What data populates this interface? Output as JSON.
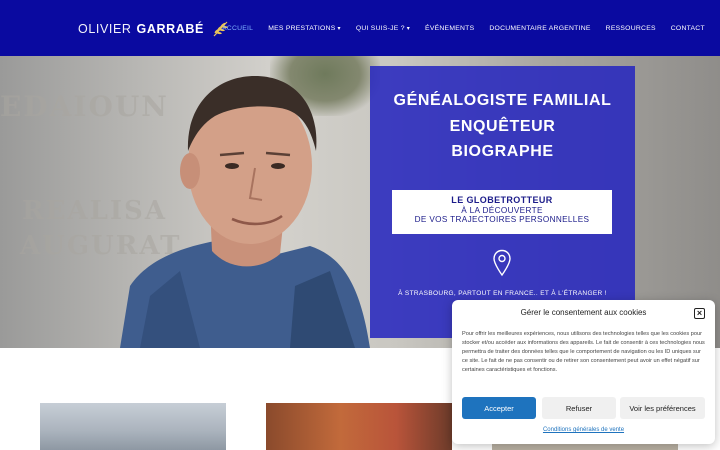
{
  "colors": {
    "header_bg": "#0a0aa0",
    "overlay_bg": "#2828be",
    "accent_blue": "#1e73be",
    "nav_active": "#7fb2ff"
  },
  "logo": {
    "first": "OLIVIER",
    "last": "GARRABÉ",
    "icon": "laurel-icon"
  },
  "nav": {
    "items": [
      {
        "label": "ACCUEIL",
        "active": true,
        "has_dropdown": false
      },
      {
        "label": "MES PRESTATIONS",
        "active": false,
        "has_dropdown": true
      },
      {
        "label": "QUI SUIS-JE ?",
        "active": false,
        "has_dropdown": true
      },
      {
        "label": "ÉVÉNEMENTS",
        "active": false,
        "has_dropdown": false
      },
      {
        "label": "DOCUMENTAIRE ARGENTINE",
        "active": false,
        "has_dropdown": false
      },
      {
        "label": "RESSOURCES",
        "active": false,
        "has_dropdown": false
      },
      {
        "label": "CONTACT",
        "active": false,
        "has_dropdown": false
      }
    ],
    "caret": "▾"
  },
  "hero": {
    "title_lines": [
      "GÉNÉALOGISTE FAMILIAL",
      "ENQUÊTEUR",
      "BIOGRAPHE"
    ],
    "box": {
      "line1": "LE GLOBETROTTEUR",
      "line2": "À LA DÉCOUVERTE",
      "line3": "DE VOS TRAJECTOIRES PERSONNELLES"
    },
    "pin_icon": "map-pin-icon",
    "location": "À STRASBOURG, PARTOUT EN FRANCE.. ET À L'ÉTRANGER !"
  },
  "consent": {
    "title": "Gérer le consentement aux cookies",
    "close": "×",
    "text": "Pour offrir les meilleures expériences, nous utilisons des technologies telles que les cookies pour stocker et/ou accéder aux informations des appareils. Le fait de consentir à ces technologies nous permettra de traiter des données telles que le comportement de navigation ou les ID uniques sur ce site. Le fait de ne pas consentir ou de retirer son consentement peut avoir un effet négatif sur certaines caractéristiques et fonctions.",
    "accept": "Accepter",
    "refuse": "Refuser",
    "prefs": "Voir les préférences",
    "link": "Conditions générales de vente"
  }
}
